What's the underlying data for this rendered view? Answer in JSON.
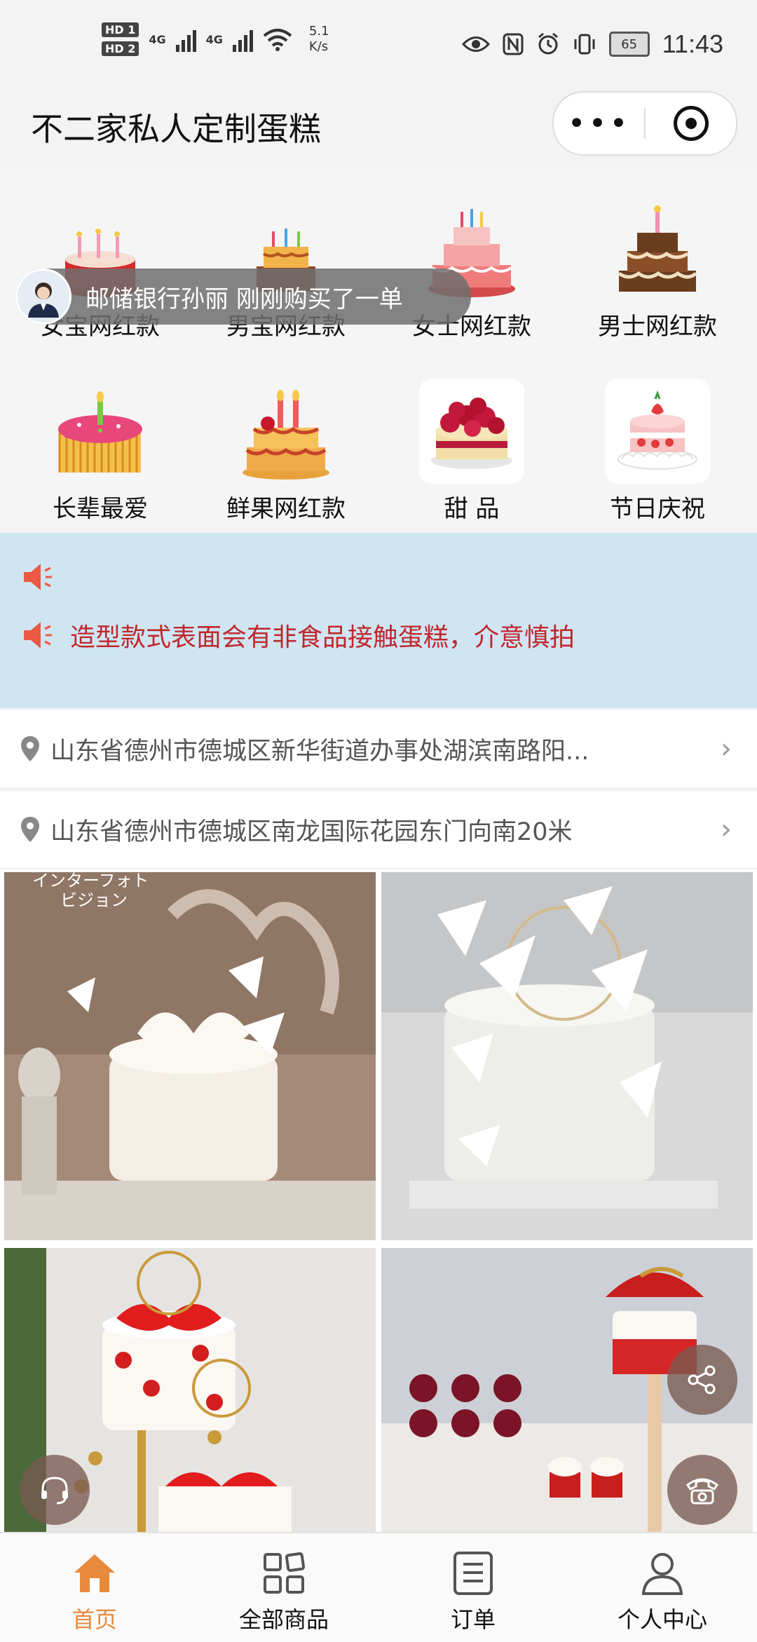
{
  "status_bar": {
    "network_speed": "5.1",
    "network_unit": "K/s",
    "battery": "65",
    "time": "11:43",
    "hd1": "HD 1",
    "hd2": "HD 2",
    "net1": "4G",
    "net2": "4G"
  },
  "header": {
    "title": "不二家私人定制蛋糕",
    "menu_label": "•••"
  },
  "categories": [
    {
      "label": "女宝网红款",
      "icon": "cake-icon"
    },
    {
      "label": "男宝网红款",
      "icon": "cake-icon"
    },
    {
      "label": "女士网红款",
      "icon": "cake-icon"
    },
    {
      "label": "男士网红款",
      "icon": "cake-icon"
    },
    {
      "label": "长辈最爱",
      "icon": "cake-icon"
    },
    {
      "label": "鲜果网红款",
      "icon": "cake-icon"
    },
    {
      "label": "甜 品",
      "icon": "dessert-icon"
    },
    {
      "label": "节日庆祝",
      "icon": "cake-icon"
    }
  ],
  "toast": {
    "text": "邮储银行孙丽 刚刚购买了一单"
  },
  "notice": {
    "line1": "",
    "line2": "造型款式表面会有非食品接触蛋糕，介意慎拍",
    "accent_color": "#c1272d"
  },
  "addresses": [
    "山东省德州市德城区新华街道办事处湖滨南路阳...",
    "山东省德州市德城区南龙国际花园东门向南20米"
  ],
  "photo_text": {
    "p1_line1": "インターフォト",
    "p1_line2": "ビジョン"
  },
  "tabbar": {
    "items": [
      {
        "label": "首页",
        "icon": "home-icon",
        "active": true
      },
      {
        "label": "全部商品",
        "icon": "grid-icon",
        "active": false
      },
      {
        "label": "订单",
        "icon": "order-icon",
        "active": false
      },
      {
        "label": "个人中心",
        "icon": "user-icon",
        "active": false
      }
    ],
    "active_color": "#e78a3c"
  }
}
